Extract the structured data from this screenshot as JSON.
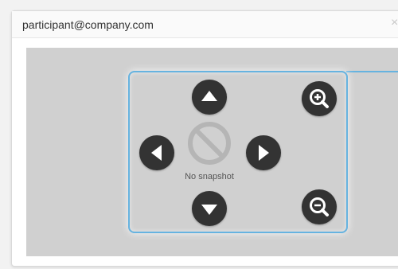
{
  "dialog": {
    "title": "participant@company.com",
    "close_label": "×"
  },
  "camera": {
    "snapshot_text": "No snapshot",
    "icons": {
      "up": "arrow-up-icon",
      "down": "arrow-down-icon",
      "left": "arrow-left-icon",
      "right": "arrow-right-icon",
      "zoom_in": "zoom-in-icon",
      "zoom_out": "zoom-out-icon",
      "no_snapshot": "prohibited-icon"
    }
  },
  "colors": {
    "frame": "#66b3e0",
    "button": "#333333",
    "view_bg": "#d0d0d0"
  }
}
